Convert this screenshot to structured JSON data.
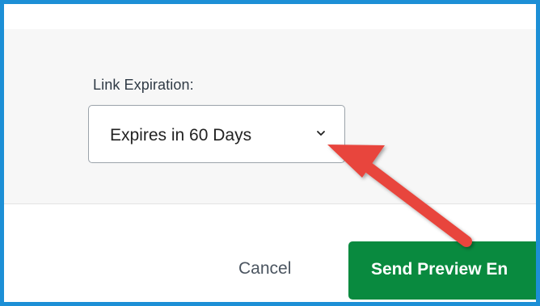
{
  "dialog": {
    "link_expiration": {
      "label": "Link Expiration:",
      "selected_value": "Expires in 60 Days",
      "dropdown_icon": "chevron-down-icon"
    },
    "footer": {
      "cancel_label": "Cancel",
      "send_label": "Send Preview En"
    }
  },
  "annotation": {
    "arrow_color": "#e8453c",
    "arrow_icon": "pointer-arrow-icon"
  },
  "colors": {
    "frame_border": "#1c8fd6",
    "primary_button": "#098a3f"
  }
}
